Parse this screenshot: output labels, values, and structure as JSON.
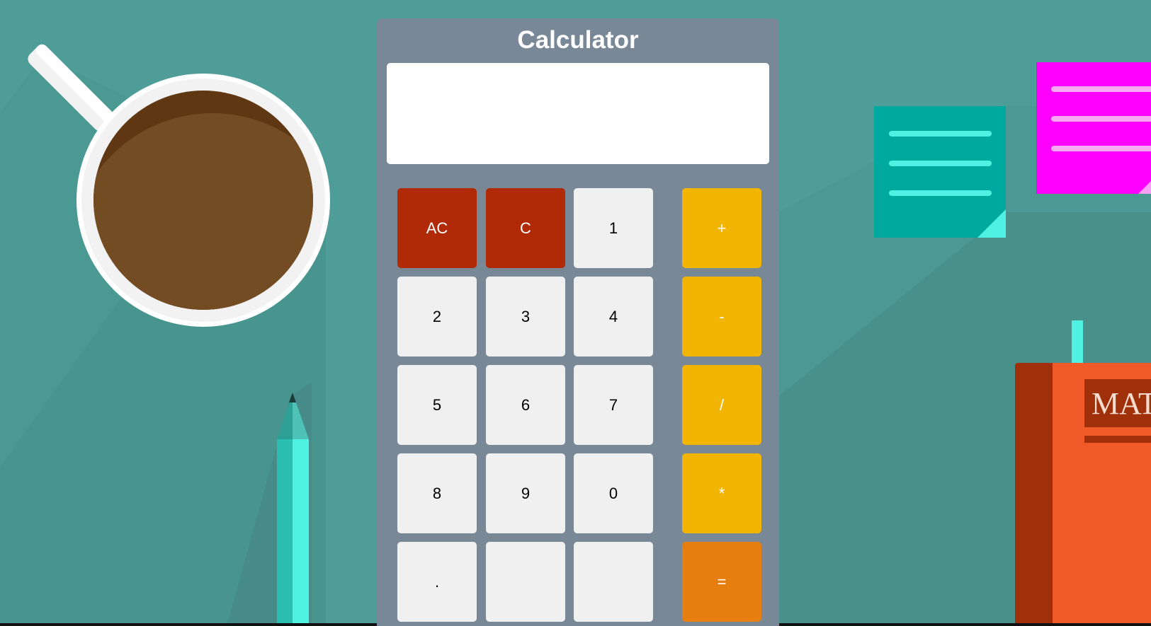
{
  "calculator": {
    "title": "Calculator",
    "display_value": ""
  },
  "keys": {
    "ac": "AC",
    "c": "C",
    "d1": "1",
    "plus": "+",
    "d2": "2",
    "d3": "3",
    "d4": "4",
    "minus": "-",
    "d5": "5",
    "d6": "6",
    "d7": "7",
    "divide": "/",
    "d8": "8",
    "d9": "9",
    "d0": "0",
    "multiply": "*",
    "dot": ".",
    "blank1": "",
    "blank2": "",
    "equals": "="
  },
  "background": {
    "book_title": "MAT"
  },
  "colors": {
    "background": "#4f9d98",
    "calculator_body": "#788897",
    "clear_keys": "#b02a07",
    "operator_keys": "#f3b503",
    "equals_key": "#e67e10",
    "digit_keys": "#f0f0f0",
    "coffee": "#744c24",
    "sticky_note_teal": "#00a99d",
    "sticky_note_magenta": "#ff00ff",
    "book_cover": "#f05a28"
  },
  "icons": [
    "coffee-cup-icon",
    "pencil-icon",
    "sticky-note-icon",
    "book-icon"
  ]
}
